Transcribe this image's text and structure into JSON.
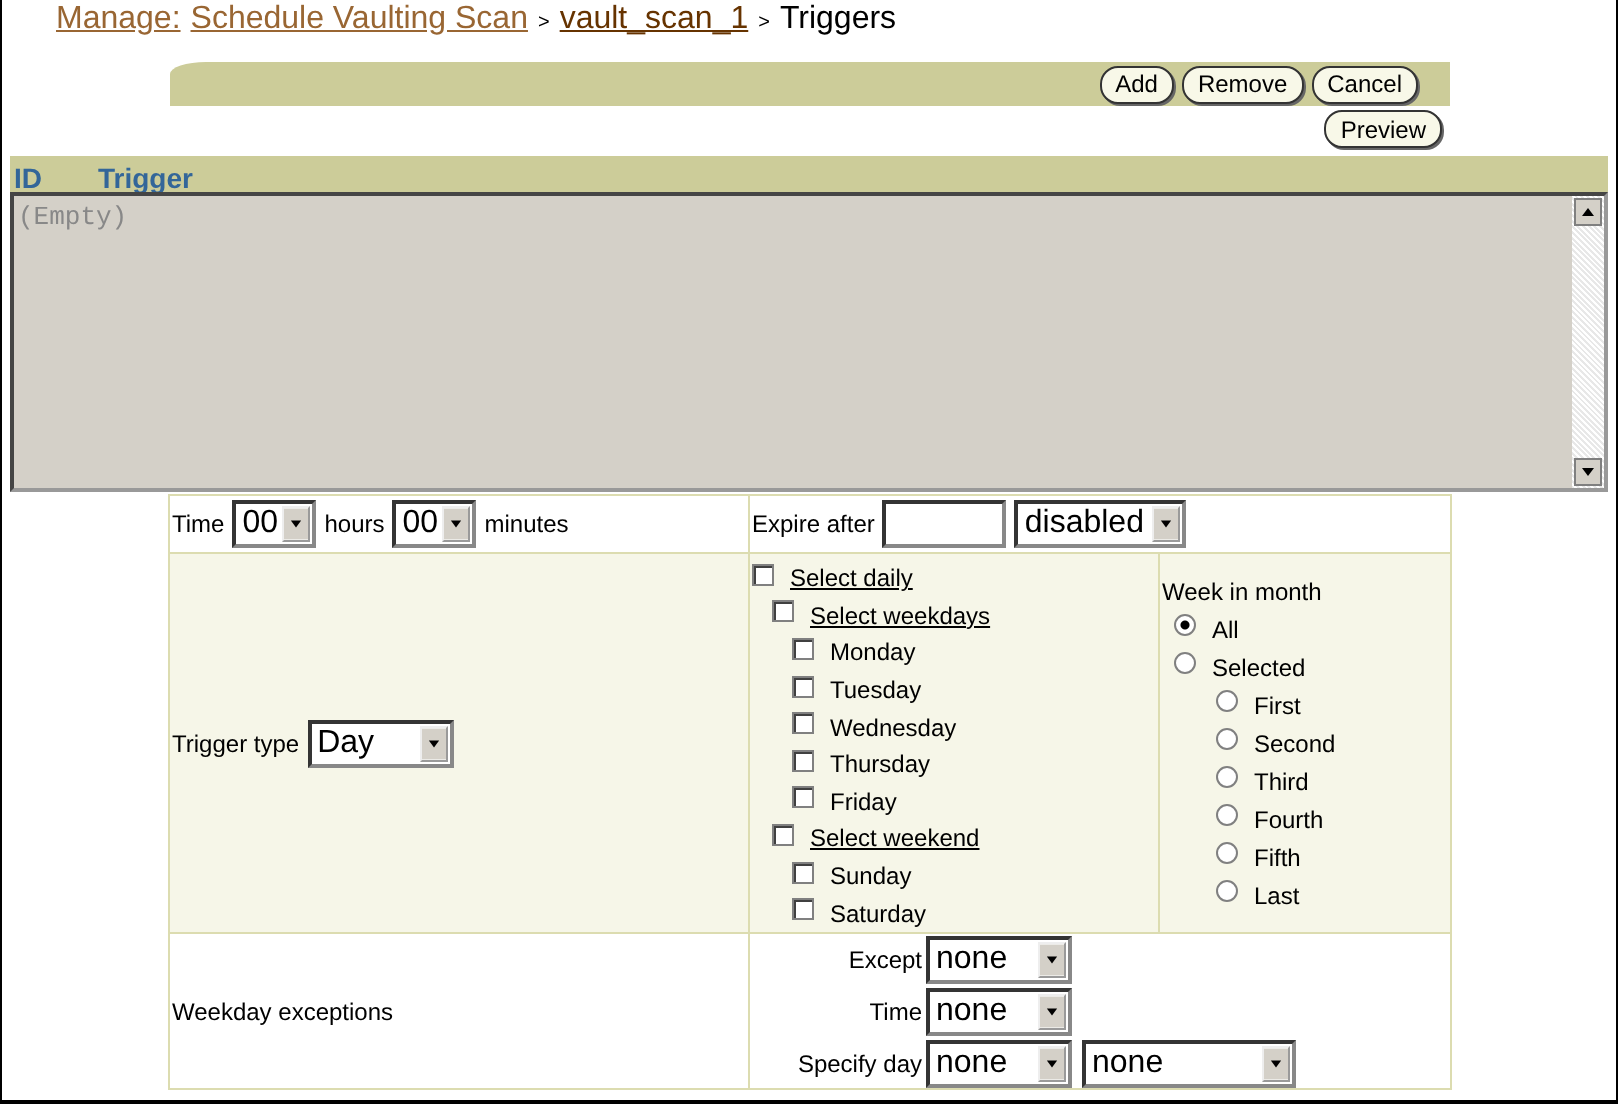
{
  "breadcrumb": [
    {
      "label": "Manage:",
      "kind": "link"
    },
    {
      "label": "Schedule Vaulting Scan",
      "kind": "link"
    },
    {
      "label": ">",
      "kind": "separator"
    },
    {
      "label": "vault_scan_1",
      "kind": "visited"
    },
    {
      "label": ">",
      "kind": "separator"
    },
    {
      "label": "Triggers",
      "kind": "current"
    }
  ],
  "toolbar": {
    "buttons": [
      "Add",
      "Remove",
      "Cancel"
    ],
    "preview": "Preview"
  },
  "list": {
    "columns": [
      "ID",
      "Trigger"
    ],
    "empty_text": "(Empty)"
  },
  "form": {
    "time": {
      "label": "Time",
      "hours": "00",
      "hours_label": "hours",
      "minutes": "00",
      "minutes_label": "minutes"
    },
    "expire": {
      "label": "Expire after",
      "unit": "disabled"
    },
    "trigger_type": {
      "label": "Trigger type",
      "value": "Day"
    },
    "days": [
      {
        "label": "Select daily",
        "checked": false,
        "children": [
          {
            "label": "Select weekdays",
            "checked": false,
            "children": [
              {
                "label": "Monday",
                "checked": false
              },
              {
                "label": "Tuesday",
                "checked": false
              },
              {
                "label": "Wednesday",
                "checked": false
              },
              {
                "label": "Thursday",
                "checked": false
              },
              {
                "label": "Friday",
                "checked": false
              }
            ]
          },
          {
            "label": "Select weekend",
            "checked": false,
            "children": [
              {
                "label": "Sunday",
                "checked": false
              },
              {
                "label": "Saturday",
                "checked": false
              }
            ]
          }
        ]
      }
    ],
    "week_in_month": {
      "label": "Week in month",
      "options": [
        {
          "label": "All",
          "selected": true
        },
        {
          "label": "Selected",
          "selected": false,
          "children": [
            {
              "label": "First",
              "selected": false
            },
            {
              "label": "Second",
              "selected": false
            },
            {
              "label": "Third",
              "selected": false
            },
            {
              "label": "Fourth",
              "selected": false
            },
            {
              "label": "Fifth",
              "selected": false
            },
            {
              "label": "Last",
              "selected": false
            }
          ]
        }
      ]
    },
    "exceptions": {
      "label": "Weekday exceptions",
      "fields": [
        {
          "label": "Except",
          "values": [
            "none"
          ]
        },
        {
          "label": "Time",
          "values": [
            "none"
          ]
        },
        {
          "label": "Specify day",
          "values": [
            "none",
            "none"
          ]
        }
      ]
    }
  }
}
